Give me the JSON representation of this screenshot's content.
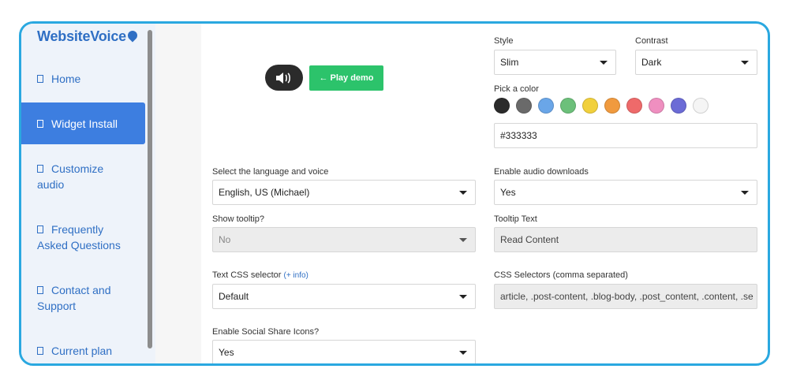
{
  "brand": {
    "name": "WebsiteVoice"
  },
  "sidebar": {
    "items": [
      {
        "label": "Home",
        "active": false
      },
      {
        "label": "Widget Install",
        "active": true
      },
      {
        "label": "Customize audio",
        "active": false
      },
      {
        "label": "Frequently Asked Questions",
        "active": false
      },
      {
        "label": "Contact and Support",
        "active": false
      },
      {
        "label": "Current plan",
        "active": false
      }
    ]
  },
  "demo": {
    "play_label": "← Play demo",
    "widget_icon": "speaker-icon"
  },
  "style": {
    "label": "Style",
    "value": "Slim"
  },
  "contrast": {
    "label": "Contrast",
    "value": "Dark"
  },
  "color": {
    "label": "Pick a color",
    "value": "#333333",
    "swatches": [
      "#2b2b2b",
      "#6a6a6a",
      "#6aa6e8",
      "#6cc07a",
      "#f1d03c",
      "#f09a3e",
      "#ee6a6a",
      "#ef8fc0",
      "#6b6bd6",
      "#f5f5f5"
    ]
  },
  "language": {
    "label": "Select the language and voice",
    "value": "English, US (Michael)"
  },
  "audio_downloads": {
    "label": "Enable audio downloads",
    "value": "Yes"
  },
  "tooltip": {
    "label": "Show tooltip?",
    "value": "No"
  },
  "tooltip_text": {
    "label": "Tooltip Text",
    "value": "Read Content"
  },
  "css_selector": {
    "label": "Text CSS selector",
    "info": "(+ info)",
    "value": "Default"
  },
  "css_selectors": {
    "label": "CSS Selectors (comma separated)",
    "value": "article, .post-content, .blog-body, .post_content, .content, .se"
  },
  "social": {
    "label": "Enable Social Share Icons?",
    "value": "Yes"
  }
}
